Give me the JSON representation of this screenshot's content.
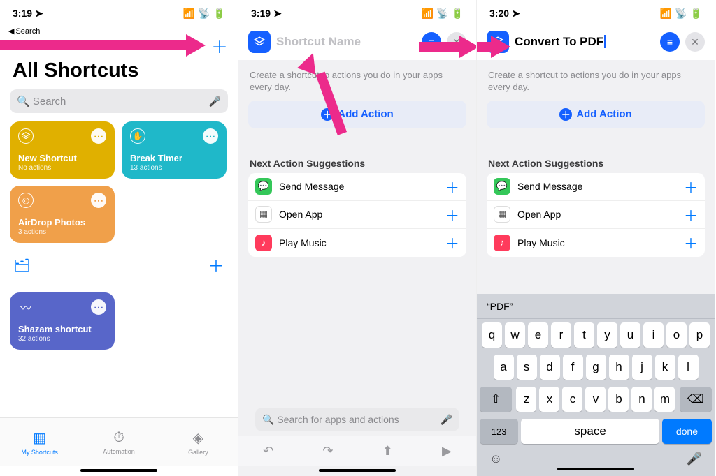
{
  "status": {
    "time1": "3:19",
    "time2": "3:19",
    "time3": "3:20",
    "back": "Search",
    "loc_glyph": "➤"
  },
  "panel1": {
    "title": "All Shortcuts",
    "search_placeholder": "Search",
    "cards": [
      {
        "name": "New Shortcut",
        "sub": "No actions",
        "color": "yellow"
      },
      {
        "name": "Break Timer",
        "sub": "13 actions",
        "color": "teal"
      },
      {
        "name": "AirDrop Photos",
        "sub": "3 actions",
        "color": "orange"
      },
      {
        "name": "Shazam shortcut",
        "sub": "32 actions",
        "color": "indigo"
      }
    ],
    "tabs": [
      {
        "label": "My Shortcuts",
        "active": true
      },
      {
        "label": "Automation",
        "active": false
      },
      {
        "label": "Gallery",
        "active": false
      }
    ]
  },
  "editor": {
    "placeholder": "Shortcut Name",
    "typed_name": "Convert To PDF",
    "hint": "Create a shortcut to actions you do in your apps every day.",
    "add_action": "Add Action",
    "section": "Next Action Suggestions",
    "suggestions": [
      {
        "label": "Send Message",
        "color": "green",
        "glyph": "💬"
      },
      {
        "label": "Open App",
        "color": "multi",
        "glyph": "▦"
      },
      {
        "label": "Play Music",
        "color": "red",
        "glyph": "♪"
      }
    ],
    "search_placeholder": "Search for apps and actions"
  },
  "keyboard": {
    "suggestion": "“PDF”",
    "rows": [
      [
        "q",
        "w",
        "e",
        "r",
        "t",
        "y",
        "u",
        "i",
        "o",
        "p"
      ],
      [
        "a",
        "s",
        "d",
        "f",
        "g",
        "h",
        "j",
        "k",
        "l"
      ],
      [
        "z",
        "x",
        "c",
        "v",
        "b",
        "n",
        "m"
      ]
    ],
    "num": "123",
    "space": "space",
    "done": "done"
  }
}
